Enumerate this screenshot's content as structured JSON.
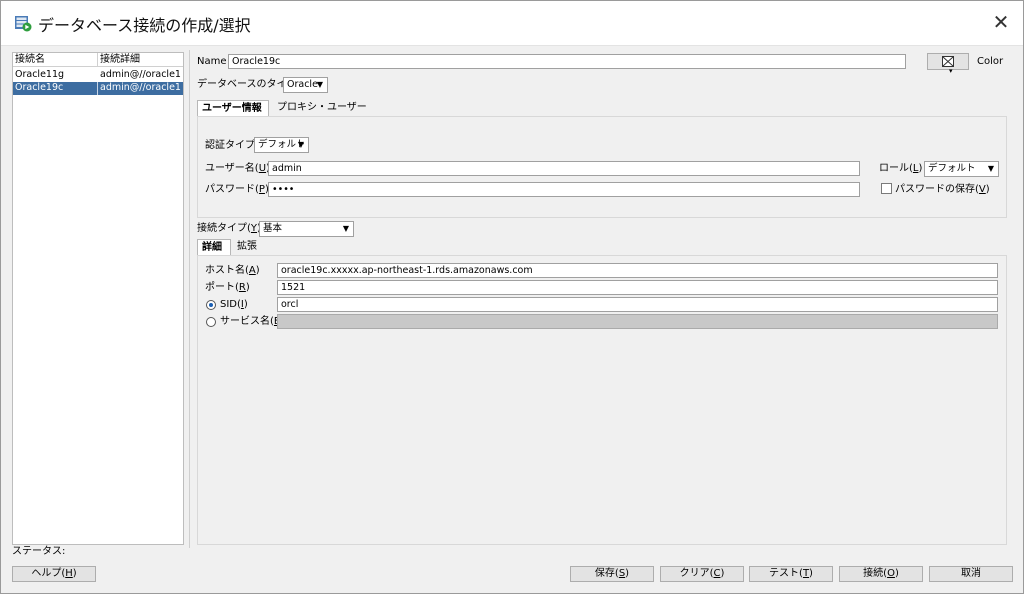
{
  "window": {
    "title": "データベース接続の作成/選択",
    "close_glyph": "✕"
  },
  "connections": {
    "headers": [
      "接続名",
      "接続詳細"
    ],
    "rows": [
      {
        "name": "Oracle11g",
        "detail": "admin@//oracle1..."
      },
      {
        "name": "Oracle19c",
        "detail": "admin@//oracle1..."
      }
    ],
    "selected_index": 1
  },
  "form": {
    "name_label": "Name",
    "name_value": "Oracle19c",
    "color_label": "Color",
    "dbtype_label": "データベースのタイプ",
    "dbtype_value": "Oracle",
    "tabs": [
      "ユーザー情報",
      "プロキシ・ユーザー"
    ],
    "auth_label": "認証タイプ",
    "auth_value": "デフォルト",
    "user_label_pre": "ユーザー名(",
    "user_label_key": "U",
    "user_label_post": ")",
    "user_value": "admin",
    "pass_label_pre": "パスワード(",
    "pass_label_key": "P",
    "pass_label_post": ")",
    "pass_value": "••••",
    "role_label_pre": "ロール(",
    "role_label_key": "L",
    "role_label_post": ")",
    "role_value": "デフォルト",
    "save_pass_pre": "パスワードの保存(",
    "save_pass_key": "V",
    "save_pass_post": ")",
    "conntype_label_pre": "接続タイプ(",
    "conntype_label_key": "Y",
    "conntype_label_post": ")",
    "conntype_value": "基本",
    "detail_tabs": [
      "詳細",
      "拡張"
    ],
    "host_label_pre": "ホスト名(",
    "host_label_key": "A",
    "host_label_post": ")",
    "host_value": "oracle19c.xxxxx.ap-northeast-1.rds.amazonaws.com",
    "port_label_pre": "ポート(",
    "port_label_key": "R",
    "port_label_post": ")",
    "port_value": "1521",
    "sid_label_pre": "SID(",
    "sid_label_key": "I",
    "sid_label_post": ")",
    "sid_value": "orcl",
    "service_label_pre": "サービス名(",
    "service_label_key": "E",
    "service_label_post": ")"
  },
  "status_label": "ステータス:",
  "buttons": {
    "help_pre": "ヘルプ(",
    "help_key": "H",
    "help_post": ")",
    "save_pre": "保存(",
    "save_key": "S",
    "save_post": ")",
    "clear_pre": "クリア(",
    "clear_key": "C",
    "clear_post": ")",
    "test_pre": "テスト(",
    "test_key": "T",
    "test_post": ")",
    "connect_pre": "接続(",
    "connect_key": "O",
    "connect_post": ")",
    "cancel": "取消"
  },
  "colors": {
    "selection": "#3d6da1",
    "accent": "#1a5fb4"
  }
}
